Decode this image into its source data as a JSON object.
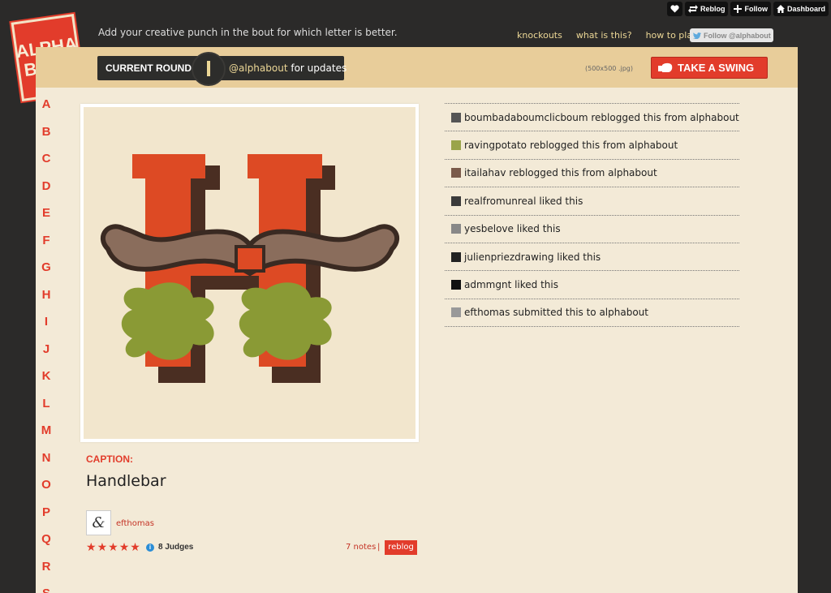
{
  "tumblr_bar": {
    "reblog_label": "Reblog",
    "follow_label": "Follow",
    "dashboard_label": "Dashboard"
  },
  "logo": {
    "line1": "ALPHA",
    "line2": "BOUT"
  },
  "tagline": "Add your creative punch in the bout for which letter is better.",
  "top_nav": {
    "knockouts": "knockouts",
    "what_is_this": "what is this?",
    "how_to_play": "how to play"
  },
  "follow_twitter": "Follow @alphabout",
  "header": {
    "current_round_label": "CURRENT ROUND:",
    "round_letter": "I",
    "updates_handle": "@alphabout",
    "updates_text": " for updates",
    "size_hint": "(500x500 .jpg)",
    "swing_label": "TAKE A SWING"
  },
  "letters": [
    "A",
    "B",
    "C",
    "D",
    "E",
    "F",
    "G",
    "H",
    "I",
    "J",
    "K",
    "L",
    "M",
    "N",
    "O",
    "P",
    "Q",
    "R",
    "S"
  ],
  "post": {
    "caption_label": "CAPTION:",
    "caption_title": "Handlebar",
    "author": "efthomas",
    "rating": 5,
    "judges": "8 Judges",
    "notes_link": "7 notes",
    "separator": "|",
    "reblog_label": "reblog"
  },
  "notes": [
    {
      "text": "boumbadaboumclicboum reblogged this from alphabout",
      "avatar_color": "#555555"
    },
    {
      "text": "ravingpotato reblogged this from alphabout",
      "avatar_color": "#9aa44a"
    },
    {
      "text": "itailahav reblogged this from alphabout",
      "avatar_color": "#7a5a4a"
    },
    {
      "text": "realfromunreal liked this",
      "avatar_color": "#3a3a3a"
    },
    {
      "text": "yesbelove liked this",
      "avatar_color": "#888888"
    },
    {
      "text": "julienpriezdrawing liked this",
      "avatar_color": "#222222"
    },
    {
      "text": "admmgnt liked this",
      "avatar_color": "#111111"
    },
    {
      "text": "efthomas submitted this to alphabout",
      "avatar_color": "#999999"
    }
  ],
  "colors": {
    "accent_red": "#e23c2b",
    "paper": "#f3ead7",
    "dark": "#2b2a29",
    "gold": "#ecd796"
  }
}
